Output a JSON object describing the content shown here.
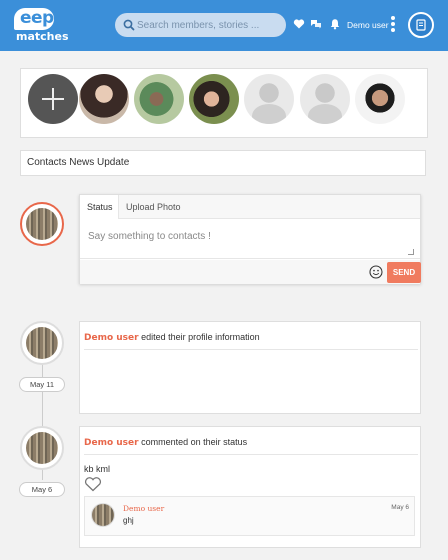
{
  "header": {
    "logo_top": "eep",
    "logo_bottom": "matches",
    "search_placeholder": "Search members, stories ...",
    "username": "Demo user",
    "icons": [
      "heart-icon",
      "chat-icon",
      "bell-icon",
      "more-icon",
      "user-card-icon"
    ]
  },
  "stories": [
    {
      "kind": "add",
      "icon": "plus-icon"
    },
    {
      "kind": "photo"
    },
    {
      "kind": "photo"
    },
    {
      "kind": "photo"
    },
    {
      "kind": "placeholder"
    },
    {
      "kind": "placeholder"
    },
    {
      "kind": "photo"
    }
  ],
  "news_header": "Contacts News Update",
  "composer": {
    "tabs": [
      "Status",
      "Upload Photo"
    ],
    "placeholder": "Say something to contacts !",
    "send_label": "SEND"
  },
  "posts": [
    {
      "author": "Demo user",
      "action": "edited their profile information",
      "date": "May 11"
    },
    {
      "author": "Demo user",
      "action": "commented on their status",
      "date": "May 6",
      "body": "kb kml",
      "comment": {
        "author": "Demo user",
        "text": "ghj",
        "date": "May 6"
      }
    }
  ],
  "colors": {
    "header_bg": "#3b8fd9",
    "accent": "#e8674a",
    "send_bg": "#f07b5f"
  }
}
